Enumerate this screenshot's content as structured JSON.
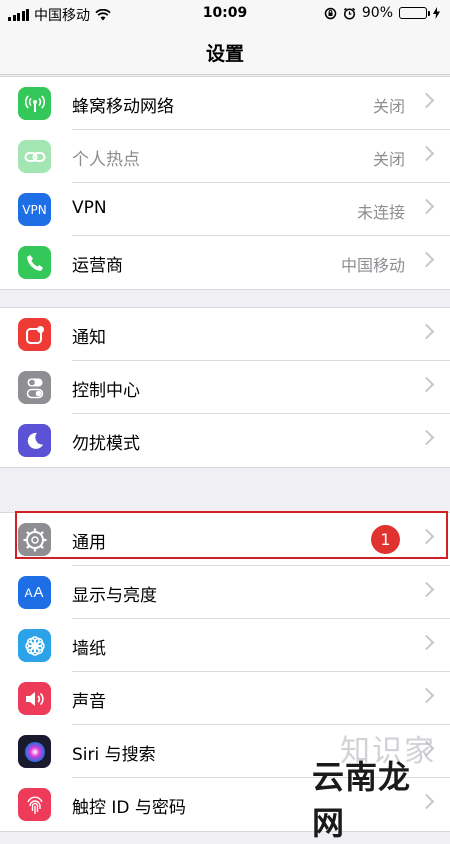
{
  "status_bar": {
    "carrier": "中国移动",
    "time": "10:09",
    "battery_percent": "90%",
    "battery_level": 0.9
  },
  "nav": {
    "title": "设置"
  },
  "groups": [
    [
      {
        "label": "蜂窝移动网络",
        "value": "关闭",
        "icon": "antenna-icon",
        "color": "#34c759"
      },
      {
        "label": "个人热点",
        "value": "关闭",
        "icon": "hotspot-icon",
        "color": "#34c759"
      },
      {
        "label": "VPN",
        "value": "未连接",
        "icon": "vpn-icon",
        "color": "#1e6ee6"
      },
      {
        "label": "运营商",
        "value": "中国移动",
        "icon": "phone-icon",
        "color": "#34c759"
      }
    ],
    [
      {
        "label": "通知",
        "value": "",
        "icon": "notification-icon",
        "color": "#ef3b36"
      },
      {
        "label": "控制中心",
        "value": "",
        "icon": "toggles-icon",
        "color": "#8e8e93"
      },
      {
        "label": "勿扰模式",
        "value": "",
        "icon": "moon-icon",
        "color": "#5b52d6"
      }
    ],
    [
      {
        "label": "通用",
        "value": "",
        "badge": "1",
        "icon": "gear-icon",
        "color": "#8e8e93"
      },
      {
        "label": "显示与亮度",
        "value": "",
        "icon": "text-size-icon",
        "color": "#1e6ee6"
      },
      {
        "label": "墙纸",
        "value": "",
        "icon": "flower-icon",
        "color": "#2ca3e8"
      },
      {
        "label": "声音",
        "value": "",
        "icon": "speaker-icon",
        "color": "#ef3b5a"
      },
      {
        "label": "Siri 与搜索",
        "value": "",
        "icon": "siri-icon",
        "color": "#1a1a2e"
      },
      {
        "label": "触控 ID 与密码",
        "value": "",
        "icon": "fingerprint-icon",
        "color": "#ef3b5a"
      }
    ]
  ],
  "watermark": {
    "top": "知识家",
    "bottom": "云南龙网"
  }
}
